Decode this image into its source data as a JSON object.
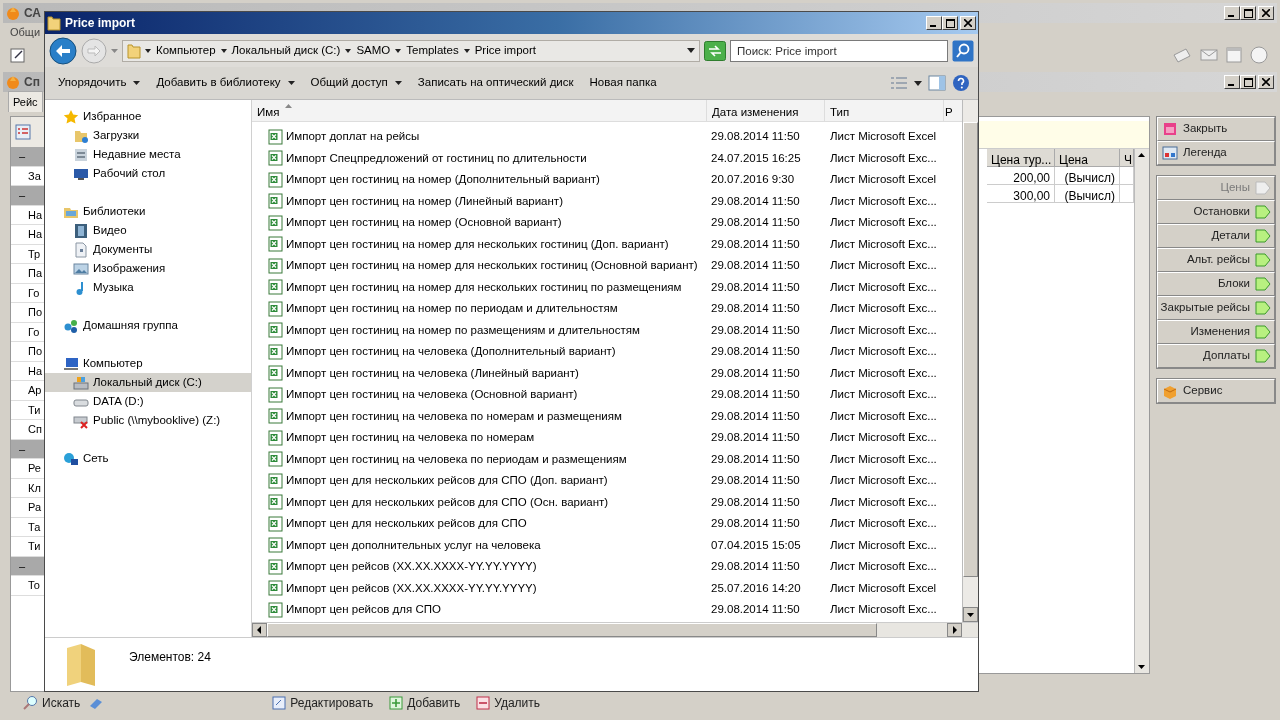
{
  "app": {
    "title": "СА",
    "menu": [
      "Общи"
    ],
    "window_title": "Сп",
    "tab": {
      "label": "Рейс",
      "selected": true
    },
    "side_rows": [
      {
        "kind": "group",
        "text": "–"
      },
      {
        "kind": "item",
        "text": "За"
      },
      {
        "kind": "group",
        "text": "–"
      },
      {
        "kind": "item",
        "text": "На"
      },
      {
        "kind": "item",
        "text": "На"
      },
      {
        "kind": "item",
        "text": "Тр"
      },
      {
        "kind": "item",
        "text": "Па"
      },
      {
        "kind": "item",
        "text": "Го"
      },
      {
        "kind": "item",
        "text": "По"
      },
      {
        "kind": "item",
        "text": "Го"
      },
      {
        "kind": "item",
        "text": "По"
      },
      {
        "kind": "item",
        "text": "На"
      },
      {
        "kind": "item",
        "text": "Ар"
      },
      {
        "kind": "item",
        "text": "Ти"
      },
      {
        "kind": "item",
        "text": "Сп"
      },
      {
        "kind": "group",
        "text": "–"
      },
      {
        "kind": "item",
        "text": "Ре"
      },
      {
        "kind": "item",
        "text": "Кл"
      },
      {
        "kind": "item",
        "text": "Ра"
      },
      {
        "kind": "item",
        "text": "Та"
      },
      {
        "kind": "item",
        "text": "Ти"
      },
      {
        "kind": "group",
        "text": "–"
      },
      {
        "kind": "item",
        "text": "То"
      }
    ],
    "table": {
      "columns": [
        "Цена тур...",
        "Цена",
        "Ч"
      ],
      "rows": [
        [
          "200,00",
          "(Вычисл)"
        ],
        [
          "300,00",
          "(Вычисл)"
        ]
      ]
    },
    "action_groups": [
      [
        {
          "label": "Закрыть",
          "kind": "close",
          "disabled": false
        },
        {
          "label": "Легенда",
          "kind": "legend",
          "disabled": false
        }
      ],
      [
        {
          "label": "Цены",
          "kind": "nav",
          "disabled": true
        },
        {
          "label": "Остановки",
          "kind": "nav",
          "disabled": false
        },
        {
          "label": "Детали",
          "kind": "nav",
          "disabled": false
        },
        {
          "label": "Альт. рейсы",
          "kind": "nav",
          "disabled": false
        },
        {
          "label": "Блоки",
          "kind": "nav",
          "disabled": false
        },
        {
          "label": "Закрытые рейсы",
          "kind": "nav",
          "disabled": false
        },
        {
          "label": "Изменения",
          "kind": "nav",
          "disabled": false
        },
        {
          "label": "Доплаты",
          "kind": "nav",
          "disabled": false
        }
      ],
      [
        {
          "label": "Сервис",
          "kind": "service",
          "disabled": false
        }
      ]
    ],
    "bottom": {
      "search": "Искать",
      "buttons": [
        {
          "label": "Редактировать",
          "kind": "edit"
        },
        {
          "label": "Добавить",
          "kind": "add"
        },
        {
          "label": "Удалить",
          "kind": "delete"
        }
      ]
    }
  },
  "explorer": {
    "title": "Price import",
    "breadcrumb": [
      "Компьютер",
      "Локальный диск (C:)",
      "SAMO",
      "Templates",
      "Price import"
    ],
    "search": {
      "placeholder": "Поиск: Price import"
    },
    "commands": [
      {
        "label": "Упорядочить",
        "dropdown": true
      },
      {
        "label": "Добавить в библиотеку",
        "dropdown": true
      },
      {
        "label": "Общий доступ",
        "dropdown": true
      },
      {
        "label": "Записать на оптический диск",
        "dropdown": false
      },
      {
        "label": "Новая папка",
        "dropdown": false
      }
    ],
    "nav": [
      {
        "label": "Избранное",
        "kind": "star",
        "selected": false,
        "children": [
          {
            "label": "Загрузки",
            "kind": "downloads",
            "selected": false
          },
          {
            "label": "Недавние места",
            "kind": "recent",
            "selected": false
          },
          {
            "label": "Рабочий стол",
            "kind": "desktop",
            "selected": false
          }
        ]
      },
      {
        "label": "Библиотеки",
        "kind": "library",
        "selected": false,
        "children": [
          {
            "label": "Видео",
            "kind": "video",
            "selected": false
          },
          {
            "label": "Документы",
            "kind": "document",
            "selected": false
          },
          {
            "label": "Изображения",
            "kind": "image",
            "selected": false
          },
          {
            "label": "Музыка",
            "kind": "music",
            "selected": false
          }
        ]
      },
      {
        "label": "Домашняя группа",
        "kind": "homegroup",
        "selected": false
      },
      {
        "label": "Компьютер",
        "kind": "computer",
        "selected": false,
        "children": [
          {
            "label": "Локальный диск (C:)",
            "kind": "disk",
            "selected": true
          },
          {
            "label": "DATA (D:)",
            "kind": "drive",
            "selected": false
          },
          {
            "label": "Public (\\\\mybooklive) (Z:)",
            "kind": "netdrive",
            "selected": false
          }
        ]
      },
      {
        "label": "Сеть",
        "kind": "network",
        "selected": false
      }
    ],
    "columns": [
      {
        "label": "Имя",
        "sorted": true
      },
      {
        "label": "Дата изменения",
        "sorted": false
      },
      {
        "label": "Тип",
        "sorted": false
      },
      {
        "label": "Р",
        "sorted": false
      }
    ],
    "files": [
      {
        "name": "Импорт доплат на рейсы",
        "modified": "29.08.2014 11:50",
        "type": "Лист Microsoft Excel"
      },
      {
        "name": "Импорт Спецпредложений от гостиниц по длительности",
        "modified": "24.07.2015 16:25",
        "type": "Лист Microsoft Exc..."
      },
      {
        "name": "Импорт цен гостиниц на номер (Дополнительный вариант)",
        "modified": "20.07.2016 9:30",
        "type": "Лист Microsoft Excel"
      },
      {
        "name": "Импорт цен гостиниц на номер (Линейный вариант)",
        "modified": "29.08.2014 11:50",
        "type": "Лист Microsoft Exc..."
      },
      {
        "name": "Импорт цен гостиниц на номер (Основной вариант)",
        "modified": "29.08.2014 11:50",
        "type": "Лист Microsoft Exc..."
      },
      {
        "name": "Импорт цен гостиниц на номер для нескольких гостиниц (Доп. вариант)",
        "modified": "29.08.2014 11:50",
        "type": "Лист Microsoft Exc..."
      },
      {
        "name": "Импорт цен гостиниц на номер для нескольких гостиниц (Основной вариант)",
        "modified": "29.08.2014 11:50",
        "type": "Лист Microsoft Exc..."
      },
      {
        "name": "Импорт цен гостиниц на номер для нескольких гостиниц по размещениям",
        "modified": "29.08.2014 11:50",
        "type": "Лист Microsoft Exc..."
      },
      {
        "name": "Импорт цен гостиниц на номер по периодам и длительностям",
        "modified": "29.08.2014 11:50",
        "type": "Лист Microsoft Exc..."
      },
      {
        "name": "Импорт цен гостиниц на номер по размещениям и длительностям",
        "modified": "29.08.2014 11:50",
        "type": "Лист Microsoft Exc..."
      },
      {
        "name": "Импорт цен гостиниц на человека (Дополнительный вариант)",
        "modified": "29.08.2014 11:50",
        "type": "Лист Microsoft Exc..."
      },
      {
        "name": "Импорт цен гостиниц на человека (Линейный вариант)",
        "modified": "29.08.2014 11:50",
        "type": "Лист Microsoft Exc..."
      },
      {
        "name": "Импорт цен гостиниц на человека (Основной вариант)",
        "modified": "29.08.2014 11:50",
        "type": "Лист Microsoft Exc..."
      },
      {
        "name": "Импорт цен гостиниц на человека по номерам и размещениям",
        "modified": "29.08.2014 11:50",
        "type": "Лист Microsoft Exc..."
      },
      {
        "name": "Импорт цен гостиниц на человека по номерам",
        "modified": "29.08.2014 11:50",
        "type": "Лист Microsoft Exc..."
      },
      {
        "name": "Импорт цен гостиниц на человека по периодам и размещениям",
        "modified": "29.08.2014 11:50",
        "type": "Лист Microsoft Exc..."
      },
      {
        "name": "Импорт цен для нескольких рейсов для СПО (Доп. вариант)",
        "modified": "29.08.2014 11:50",
        "type": "Лист Microsoft Exc..."
      },
      {
        "name": "Импорт цен для нескольких рейсов для СПО (Осн. вариант)",
        "modified": "29.08.2014 11:50",
        "type": "Лист Microsoft Exc..."
      },
      {
        "name": "Импорт цен для нескольких рейсов для СПО",
        "modified": "29.08.2014 11:50",
        "type": "Лист Microsoft Exc..."
      },
      {
        "name": "Импорт цен дополнительных услуг на человека",
        "modified": "07.04.2015 15:05",
        "type": "Лист Microsoft Exc..."
      },
      {
        "name": "Импорт цен рейсов (XX.XX.XXXX-YY.YY.YYYY)",
        "modified": "29.08.2014 11:50",
        "type": "Лист Microsoft Exc..."
      },
      {
        "name": "Импорт цен рейсов (XX.XX.XXXX-YY.YY.YYYY)",
        "modified": "25.07.2016 14:20",
        "type": "Лист Microsoft Excel"
      },
      {
        "name": "Импорт цен рейсов для СПО",
        "modified": "29.08.2014 11:50",
        "type": "Лист Microsoft Exc..."
      }
    ],
    "status": "Элементов: 24"
  }
}
